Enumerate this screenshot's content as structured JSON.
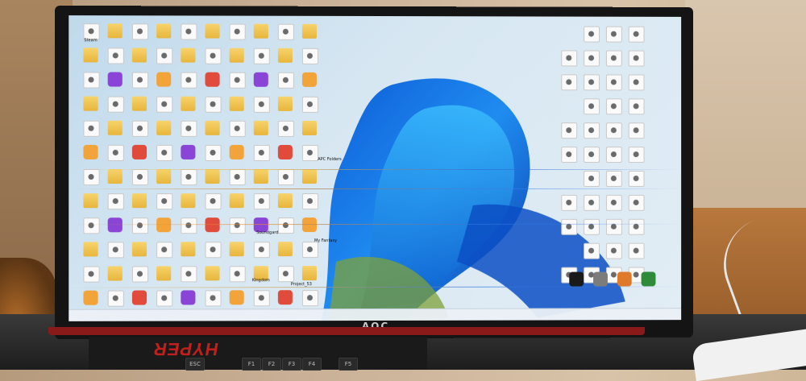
{
  "monitor": {
    "brand_label": "AOC"
  },
  "keyboard": {
    "brand": "HYPER",
    "keys": [
      "ESC",
      "F1",
      "F2",
      "F3",
      "F4",
      "F5"
    ]
  },
  "desktop": {
    "visible_labels": [
      "Steam",
      "My Fantasy",
      "Project_53",
      "APC Folders",
      "Soundgard",
      "Kingdom"
    ]
  }
}
